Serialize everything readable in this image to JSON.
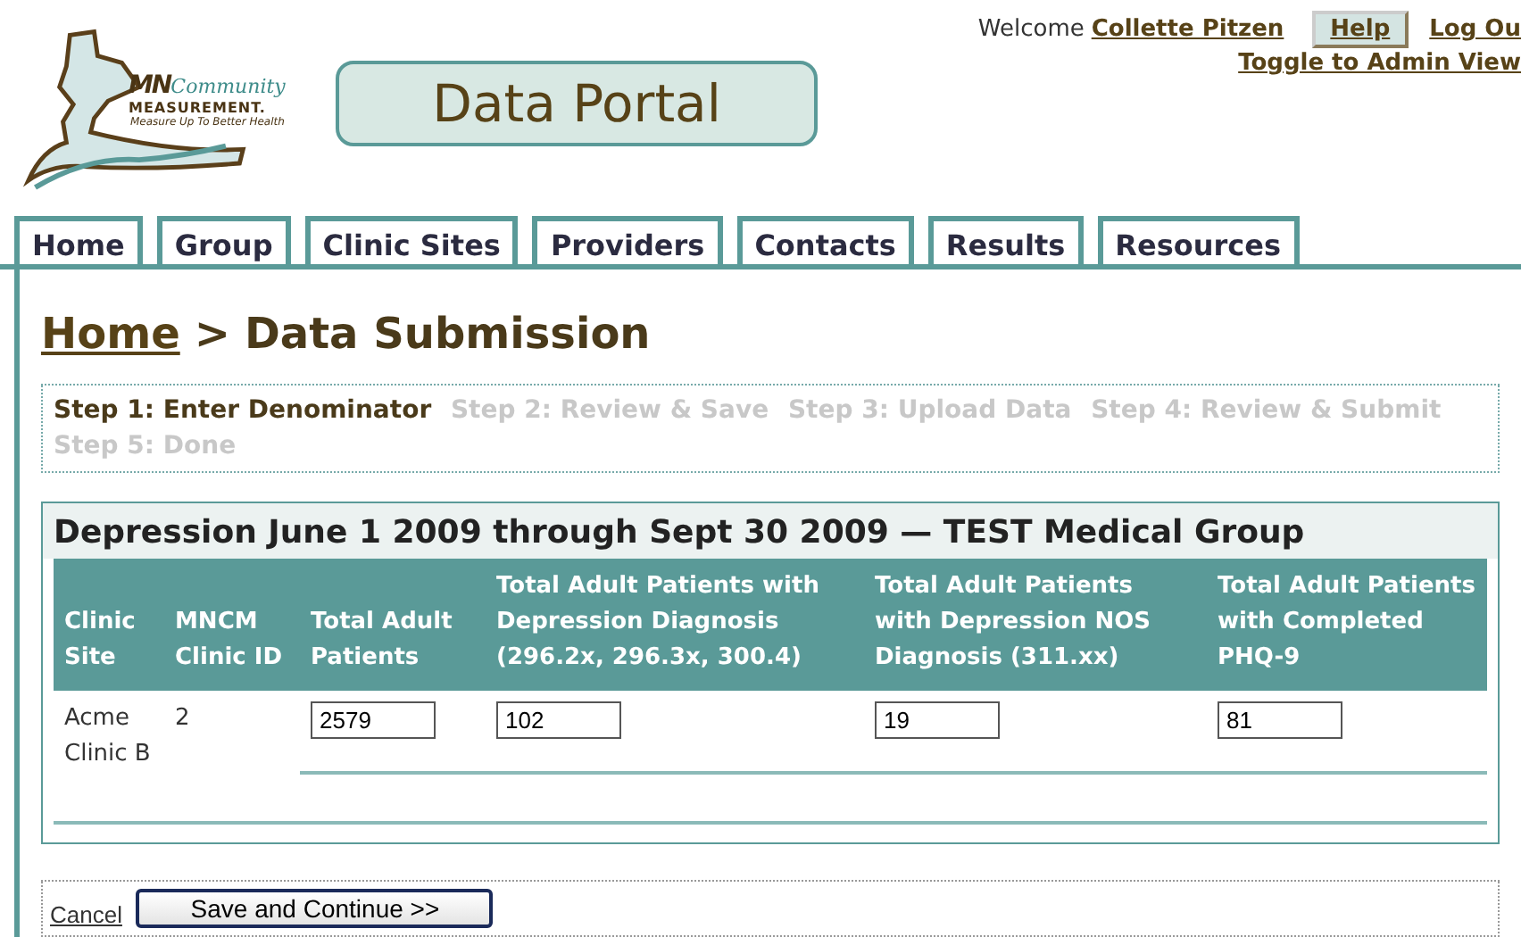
{
  "logo": {
    "mn": "MN",
    "community": "Community",
    "measurement": "MEASUREMENT.",
    "tagline": "Measure Up To Better Health"
  },
  "portal_title": "Data Portal",
  "user_bar": {
    "welcome": "Welcome",
    "user": "Collette Pitzen",
    "help": "Help",
    "logout": "Log Ou",
    "admin_toggle": "Toggle to Admin View"
  },
  "tabs": [
    {
      "label": "Home"
    },
    {
      "label": "Group"
    },
    {
      "label": "Clinic Sites"
    },
    {
      "label": "Providers"
    },
    {
      "label": "Contacts"
    },
    {
      "label": "Results"
    },
    {
      "label": "Resources"
    }
  ],
  "breadcrumb": {
    "link": "Home",
    "separator": ">",
    "current": "Data Submission"
  },
  "steps": [
    {
      "label": "Step 1: Enter Denominator",
      "selected": true
    },
    {
      "label": "Step 2: Review & Save",
      "selected": false
    },
    {
      "label": "Step 3: Upload Data",
      "selected": false
    },
    {
      "label": "Step 4: Review & Submit",
      "selected": false
    },
    {
      "label": "Step 5: Done",
      "selected": false
    }
  ],
  "panel": {
    "title": "Depression June 1 2009 through Sept 30 2009 — TEST Medical Group",
    "table": {
      "columns": [
        "Clinic Site",
        "MNCM Clinic ID",
        "Total Adult Patients",
        "Total Adult Patients with Depression Diagnosis (296.2x, 296.3x, 300.4)",
        "Total Adult Patients with Depression NOS Diagnosis (311.xx)",
        "Total Adult Patients with Completed PHQ-9"
      ],
      "rows": [
        {
          "clinic_site": "Acme Clinic B",
          "clinic_id": "2",
          "values": [
            "2579",
            "102",
            "19",
            "81"
          ]
        }
      ]
    }
  },
  "actions": {
    "cancel": "Cancel",
    "save": "Save and Continue >>"
  }
}
